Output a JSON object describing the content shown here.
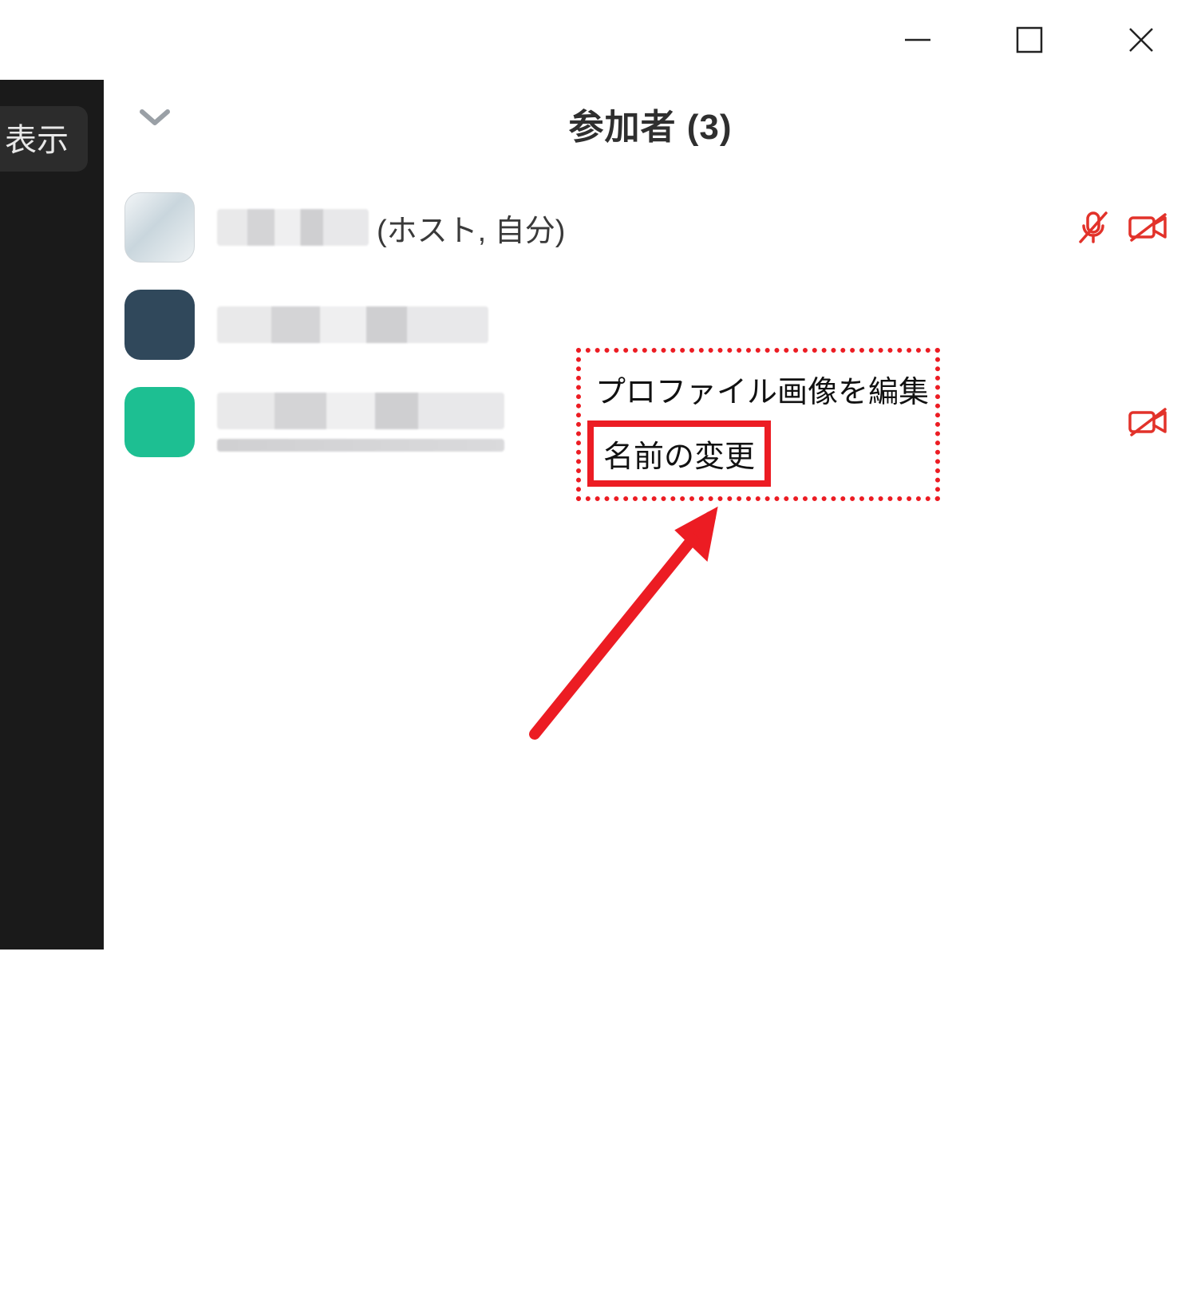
{
  "sidebar": {
    "view_label": "表示"
  },
  "window_controls": {
    "minimize": "minimize",
    "maximize": "maximize",
    "close": "close"
  },
  "panel": {
    "collapse_icon": "chevron-down",
    "title": "参加者 (3)"
  },
  "participants": [
    {
      "avatar_color": "light",
      "name_redacted": true,
      "role_suffix": "(ホスト, 自分)",
      "mic_muted": true,
      "cam_off": true
    },
    {
      "avatar_color": "navy",
      "name_redacted": true,
      "role_suffix": "",
      "mic_muted": false,
      "cam_off": false
    },
    {
      "avatar_color": "green",
      "name_redacted": true,
      "role_suffix": "",
      "mic_muted": false,
      "cam_off": true
    }
  ],
  "context_menu": {
    "items": [
      {
        "label": "プロファイル画像を編集",
        "highlighted": false
      },
      {
        "label": "名前の変更",
        "highlighted": true
      }
    ]
  },
  "annotation": {
    "kind": "arrow",
    "color": "#ec1c23"
  }
}
